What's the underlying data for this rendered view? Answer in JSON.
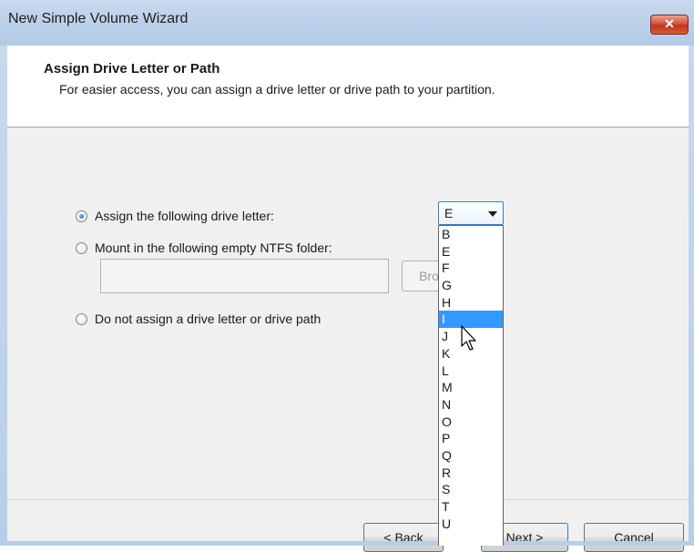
{
  "window": {
    "title": "New Simple Volume Wizard",
    "close_glyph": "✕"
  },
  "header": {
    "title": "Assign Drive Letter or Path",
    "subtitle": "For easier access, you can assign a drive letter or drive path to your partition."
  },
  "options": [
    {
      "label": "Assign the following drive letter:",
      "checked": true
    },
    {
      "label": "Mount in the following empty NTFS folder:",
      "checked": false
    },
    {
      "label": "Do not assign a drive letter or drive path",
      "checked": false
    }
  ],
  "drive_letter": {
    "selected": "E",
    "highlighted": "I",
    "list": [
      "B",
      "E",
      "F",
      "G",
      "H",
      "I",
      "J",
      "K",
      "L",
      "M",
      "N",
      "O",
      "P",
      "Q",
      "R",
      "S",
      "T",
      "U"
    ]
  },
  "folder_input": {
    "value": ""
  },
  "buttons": {
    "browse": "Bro",
    "back": "< Back",
    "next": "Next >",
    "cancel": "Cancel"
  }
}
